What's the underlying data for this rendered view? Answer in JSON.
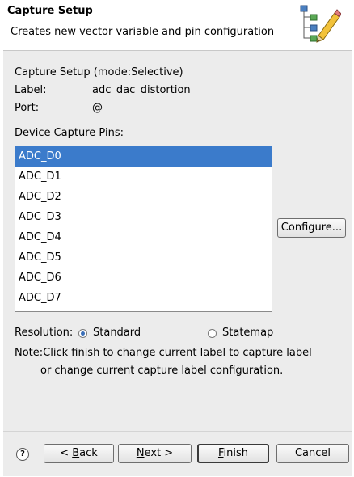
{
  "header": {
    "title": "Capture Setup",
    "description": "Creates new vector variable and pin configuration"
  },
  "info": {
    "heading": "Capture Setup (mode:Selective)",
    "label_key": "Label:",
    "label_value": "adc_dac_distortion",
    "port_key": "Port:",
    "port_value": "@"
  },
  "pins": {
    "heading": "Device Capture Pins:",
    "items": [
      "ADC_D0",
      "ADC_D1",
      "ADC_D2",
      "ADC_D3",
      "ADC_D4",
      "ADC_D5",
      "ADC_D6",
      "ADC_D7"
    ],
    "selected_index": 0,
    "configure_label": "Configure..."
  },
  "resolution": {
    "label": "Resolution:",
    "options": [
      "Standard",
      "Statemap"
    ],
    "selected": "Standard"
  },
  "note": {
    "line1": "Note:Click finish to change current label to capture label",
    "line2": "or change current capture label configuration."
  },
  "footer": {
    "help_symbol": "?",
    "back_prefix": "< ",
    "back_mnemonic": "B",
    "back_rest": "ack",
    "next_mnemonic": "N",
    "next_rest": "ext >",
    "finish_mnemonic": "F",
    "finish_rest": "inish",
    "cancel_label": "Cancel"
  },
  "colors": {
    "selection": "#3b7bcb",
    "window_bg": "#ececec",
    "radio_dot": "#3b6fb8"
  }
}
